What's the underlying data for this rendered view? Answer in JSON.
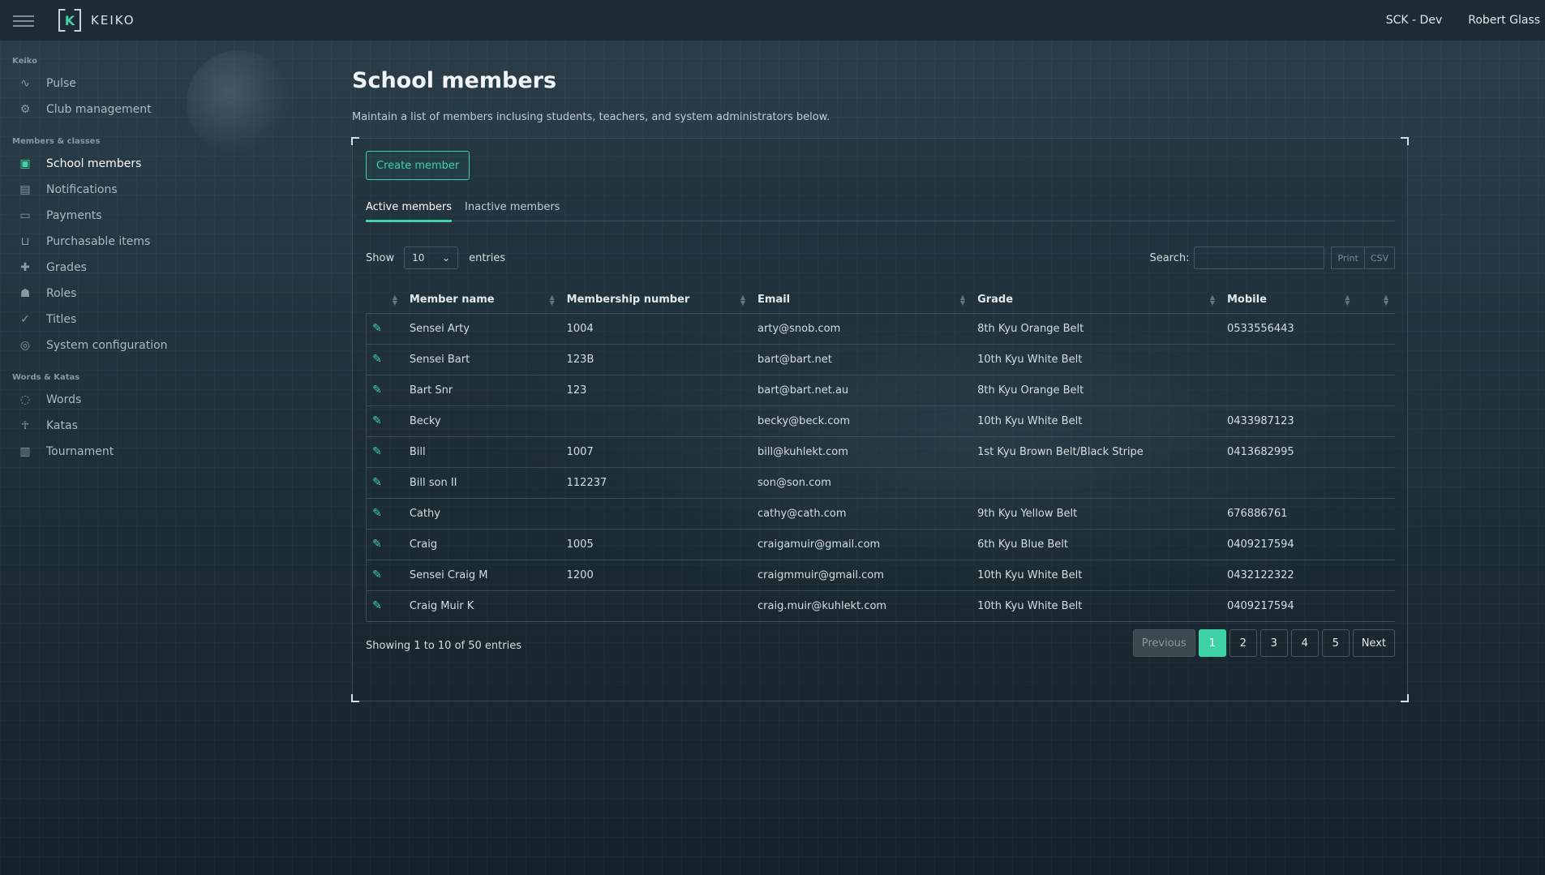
{
  "header": {
    "app_name": "KEIKO",
    "logo_letter": "K",
    "context": "SCK - Dev",
    "user": "Robert Glass"
  },
  "sidebar": {
    "sections": [
      {
        "title": "Keiko",
        "items": [
          {
            "label": "Pulse",
            "icon": "pulse-icon",
            "glyph": "∿"
          },
          {
            "label": "Club management",
            "icon": "gear-icon",
            "glyph": "⚙"
          }
        ]
      },
      {
        "title": "Members & classes",
        "items": [
          {
            "label": "School members",
            "icon": "member-badge-icon",
            "glyph": "▣",
            "active": true
          },
          {
            "label": "Notifications",
            "icon": "message-icon",
            "glyph": "▤"
          },
          {
            "label": "Payments",
            "icon": "card-icon",
            "glyph": "▭"
          },
          {
            "label": "Purchasable items",
            "icon": "basket-icon",
            "glyph": "⊔"
          },
          {
            "label": "Grades",
            "icon": "plus-icon",
            "glyph": "✚"
          },
          {
            "label": "Roles",
            "icon": "users-icon",
            "glyph": "☗"
          },
          {
            "label": "Titles",
            "icon": "check-circle-icon",
            "glyph": "✓"
          },
          {
            "label": "System configuration",
            "icon": "toggle-icon",
            "glyph": "◎"
          }
        ]
      },
      {
        "title": "Words & Katas",
        "items": [
          {
            "label": "Words",
            "icon": "chat-icon",
            "glyph": "◌"
          },
          {
            "label": "Katas",
            "icon": "figure-icon",
            "glyph": "☥"
          },
          {
            "label": "Tournament",
            "icon": "bracket-icon",
            "glyph": "▥"
          }
        ]
      }
    ]
  },
  "main": {
    "title": "School members",
    "subtitle": "Maintain a list of members inclusing students, teachers, and system administrators below.",
    "create_label": "Create member",
    "tabs": [
      {
        "label": "Active members",
        "active": true
      },
      {
        "label": "Inactive members",
        "active": false
      }
    ],
    "show_label": "Show",
    "show_value": "10",
    "entries_label": "entries",
    "search_label": "Search:",
    "search_value": "",
    "print_label": "Print",
    "csv_label": "CSV",
    "columns": [
      "",
      "Member name",
      "Membership number",
      "Email",
      "Grade",
      "Mobile",
      ""
    ],
    "rows": [
      [
        "Sensei Arty",
        "1004",
        "arty@snob.com",
        "8th Kyu Orange Belt",
        "0533556443"
      ],
      [
        "Sensei Bart",
        "123B",
        "bart@bart.net",
        "10th Kyu White Belt",
        ""
      ],
      [
        "Bart Snr",
        "123",
        "bart@bart.net.au",
        "8th Kyu Orange Belt",
        ""
      ],
      [
        "Becky",
        "",
        "becky@beck.com",
        "10th Kyu White Belt",
        "0433987123"
      ],
      [
        "Bill",
        "1007",
        "bill@kuhlekt.com",
        "1st Kyu Brown Belt/Black Stripe",
        "0413682995"
      ],
      [
        "Bill son II",
        "112237",
        "son@son.com",
        "",
        ""
      ],
      [
        "Cathy",
        "",
        "cathy@cath.com",
        "9th Kyu Yellow Belt",
        "676886761"
      ],
      [
        "Craig",
        "1005",
        "craigamuir@gmail.com",
        "6th Kyu Blue Belt",
        "0409217594"
      ],
      [
        "Sensei Craig M",
        "1200",
        "craigmmuir@gmail.com",
        "10th Kyu White Belt",
        "0432122322"
      ],
      [
        "Craig Muir K",
        "",
        "craig.muir@kuhlekt.com",
        "10th Kyu White Belt",
        "0409217594"
      ]
    ],
    "showing_text": "Showing 1 to 10 of 50 entries",
    "pager": {
      "previous": "Previous",
      "pages": [
        "1",
        "2",
        "3",
        "4",
        "5"
      ],
      "current": "1",
      "next": "Next"
    }
  },
  "colors": {
    "accent": "#3fd2a6",
    "topbar": "#1c2b35"
  }
}
